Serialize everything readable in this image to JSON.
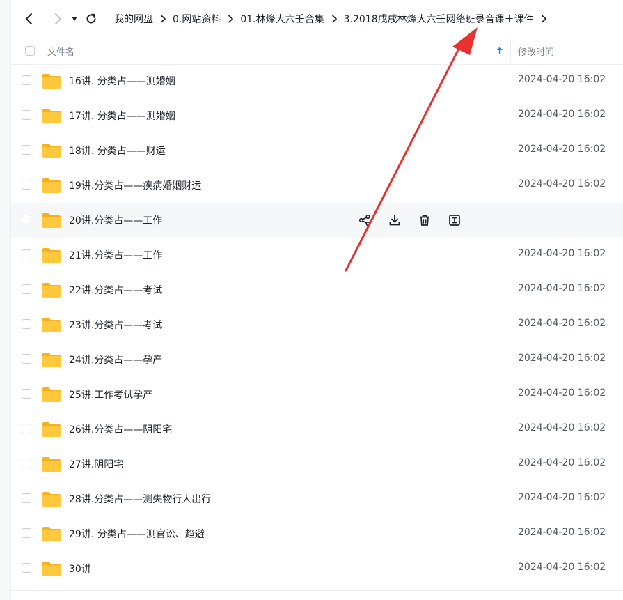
{
  "nav": {
    "breadcrumbs": [
      "我的网盘",
      "0.网站资料",
      "01.林烽大六壬合集",
      "3.2018戊戌林烽大六壬网络班录音课＋课件"
    ]
  },
  "header": {
    "name_col": "文件名",
    "time_col": "修改时间"
  },
  "files": [
    {
      "name": "16讲. 分类占——测婚姻",
      "time": "2024-04-20 16:02"
    },
    {
      "name": "17讲. 分类占——测婚姻",
      "time": "2024-04-20 16:02"
    },
    {
      "name": "18讲. 分类占——财运",
      "time": "2024-04-20 16:02"
    },
    {
      "name": "19讲.分类占——疾病婚姻财运",
      "time": "2024-04-20 16:02"
    },
    {
      "name": "20讲.分类占——工作",
      "time": ""
    },
    {
      "name": "21讲.分类占——工作",
      "time": "2024-04-20 16:02"
    },
    {
      "name": "22讲.分类占——考试",
      "time": "2024-04-20 16:02"
    },
    {
      "name": "23讲.分类占——考试",
      "time": "2024-04-20 16:02"
    },
    {
      "name": "24讲.分类占——孕产",
      "time": "2024-04-20 16:02"
    },
    {
      "name": "25讲.工作考试孕产",
      "time": "2024-04-20 16:02"
    },
    {
      "name": "26讲.分类占——阴阳宅",
      "time": "2024-04-20 16:02"
    },
    {
      "name": "27讲.阴阳宅",
      "time": "2024-04-20 16:02"
    },
    {
      "name": "28讲.分类占——测失物行人出行",
      "time": "2024-04-20 16:02"
    },
    {
      "name": "29讲. 分类占——测官讼、趋避",
      "time": "2024-04-20 16:02"
    },
    {
      "name": "30讲",
      "time": "2024-04-20 16:02"
    }
  ],
  "hover_row_index": 4,
  "row_actions": [
    "share-icon",
    "download-icon",
    "delete-icon",
    "rename-icon"
  ],
  "colors": {
    "folder": "#FFC83D",
    "folder_back": "#F6B21E",
    "accent": "#1E88E5",
    "annotation_arrow": "#E8302F"
  }
}
